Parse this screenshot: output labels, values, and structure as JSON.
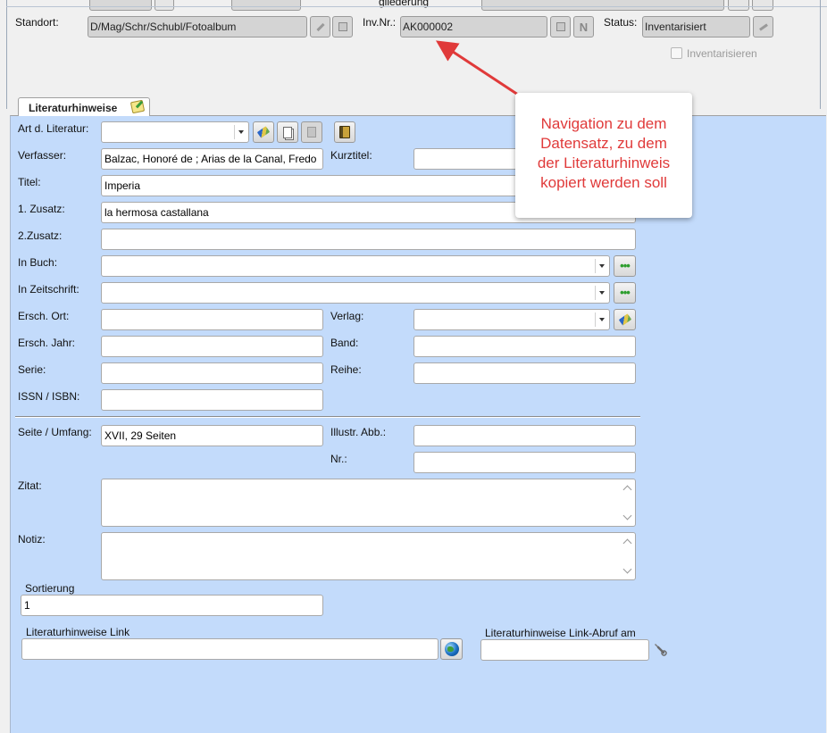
{
  "top": {
    "gliederung_label": "gliederung",
    "standort_label": "Standort:",
    "standort_value": "D/Mag/Schr/Schubl/Fotoalbum",
    "invnr_label": "Inv.Nr.:",
    "invnr_value": "AK000002",
    "n_button_label": "N",
    "status_label": "Status:",
    "status_value": "Inventarisiert",
    "inventarisieren_label": "Inventarisieren"
  },
  "tab": {
    "label": "Literaturhinweise"
  },
  "form": {
    "art_label": "Art d. Literatur:",
    "verfasser_label": "Verfasser:",
    "verfasser_value": "Balzac, Honoré de ; Arias de la Canal, Fredo",
    "kurztitel_label": "Kurztitel:",
    "titel_label": "Titel:",
    "titel_value": "Imperia",
    "zusatz1_label": "1. Zusatz:",
    "zusatz1_value": "la hermosa castallana",
    "zusatz2_label": "2.Zusatz:",
    "inbuch_label": "In Buch:",
    "inzeitschrift_label": "In Zeitschrift:",
    "erschort_label": "Ersch. Ort:",
    "verlag_label": "Verlag:",
    "erschjahr_label": "Ersch. Jahr:",
    "band_label": "Band:",
    "serie_label": "Serie:",
    "reihe_label": "Reihe:",
    "issn_label": "ISSN / ISBN:",
    "seite_label": "Seite / Umfang:",
    "seite_value": "XVII, 29 Seiten",
    "illustr_label": "Illustr. Abb.:",
    "nr_label": "Nr.:",
    "zitat_label": "Zitat:",
    "notiz_label": "Notiz:",
    "sortierung_label": "Sortierung",
    "sortierung_value": "1",
    "link_label": "Literaturhinweise Link",
    "link_abruf_label": "Literaturhinweise Link-Abruf am"
  },
  "callout": {
    "lines": [
      "Navigation zu dem",
      "Datensatz, zu dem",
      "der Literaturhinweis",
      "kopiert werden soll"
    ],
    "color": "#e03a3a"
  },
  "colors": {
    "panel": "#c3dbfb",
    "annotation_arrow": "#e03a3a"
  }
}
